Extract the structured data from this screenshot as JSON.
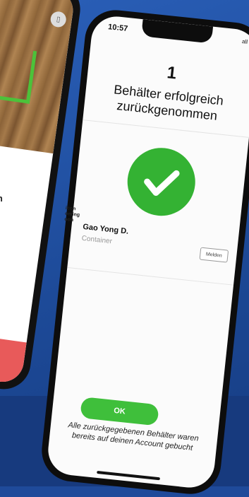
{
  "left_phone": {
    "label": "annen",
    "hint_icon": "info-icon"
  },
  "right_phone": {
    "time": "10:57",
    "signal": "all",
    "count": "1",
    "title": "Behälter erfolgreich zurückgenommen",
    "edge_text": "icon\noming\noon",
    "user": {
      "name": "Gao Yong D.",
      "subtitle": "Container"
    },
    "report_button": "Melden",
    "ok_button": "OK",
    "footer_note": "Alle zurückgegebenen Behälter waren bereits auf deinen Account gebucht"
  },
  "colors": {
    "background": "#1f4a9a",
    "success_green": "#34b233",
    "left_red": "#e85a5a"
  }
}
